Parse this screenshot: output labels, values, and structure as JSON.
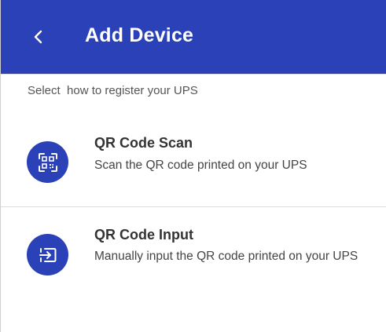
{
  "header": {
    "title": "Add Device",
    "back_icon": "chevron-left-icon"
  },
  "subtitle": "Select  how to register your UPS",
  "options": [
    {
      "title": "QR Code Scan",
      "description": "Scan the QR code printed on your UPS",
      "icon": "qr-scan-icon"
    },
    {
      "title": "QR Code Input",
      "description": "Manually input the QR code printed on your UPS",
      "icon": "input-entry-icon"
    }
  ],
  "colors": {
    "primary": "#2b41b8",
    "header_text": "#ffffff",
    "subtitle_text": "#555555",
    "title_text": "#333333",
    "divider": "#dcdcdc"
  }
}
